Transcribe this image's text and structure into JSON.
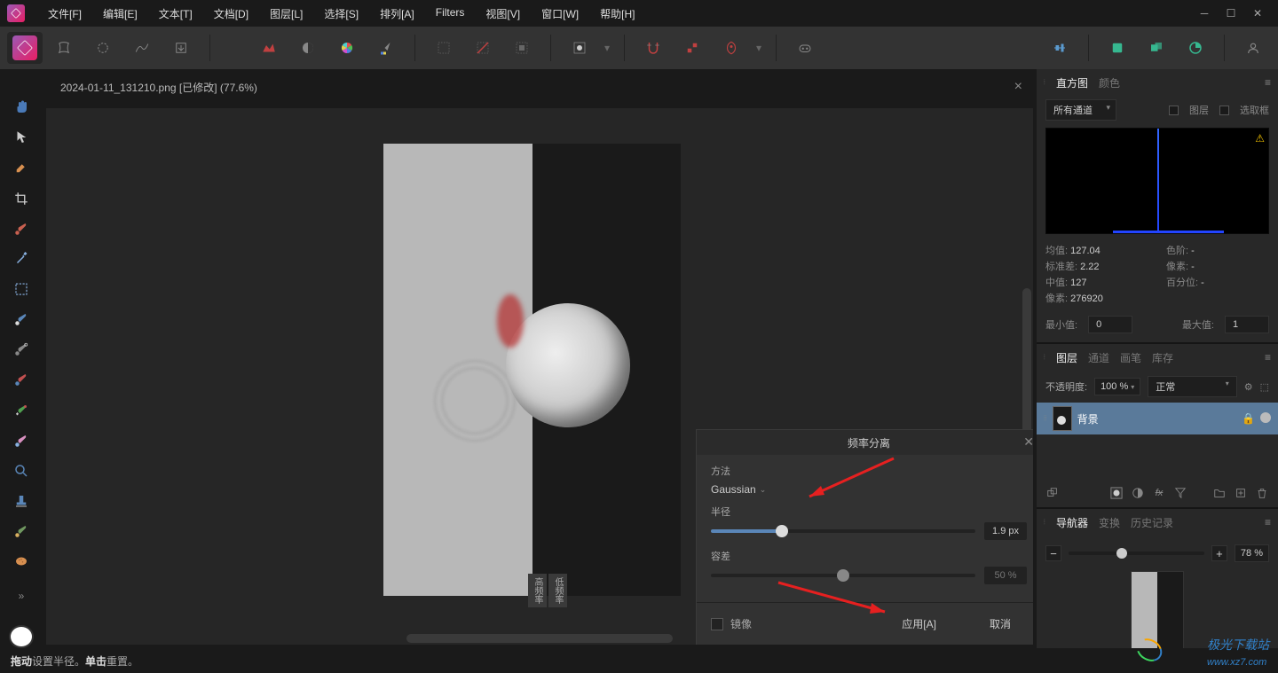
{
  "menu": {
    "file": "文件[F]",
    "edit": "编辑[E]",
    "text": "文本[T]",
    "document": "文档[D]",
    "layer": "图层[L]",
    "select": "选择[S]",
    "arrange": "排列[A]",
    "filters": "Filters",
    "view": "视图[V]",
    "window": "窗口[W]",
    "help": "帮助[H]"
  },
  "doc": {
    "tab_title": "2024-01-11_131210.png [已修改] (77.6%)",
    "split_high": "高频率",
    "split_low": "低频率"
  },
  "dialog": {
    "title": "频率分离",
    "method_label": "方法",
    "method_value": "Gaussian",
    "radius_label": "半径",
    "radius_value": "1.9 px",
    "tolerance_label": "容差",
    "tolerance_value": "50 %",
    "mirror": "镜像",
    "apply": "应用[A]",
    "cancel": "取消"
  },
  "histogram": {
    "tab1": "直方图",
    "tab2": "颜色",
    "channel": "所有通道",
    "opt_layer": "图层",
    "opt_selection": "选取框",
    "mean_lbl": "均值:",
    "mean_val": "127.04",
    "stddev_lbl": "标准差:",
    "stddev_val": "2.22",
    "median_lbl": "中值:",
    "median_val": "127",
    "pixels_lbl": "像素:",
    "pixels_val": "276920",
    "level_lbl": "色阶:",
    "level_val": "-",
    "px2_lbl": "像素:",
    "px2_val": "-",
    "pct_lbl": "百分位:",
    "pct_val": "-",
    "min_lbl": "最小值:",
    "min_val": "0",
    "max_lbl": "最大值:",
    "max_val": "1"
  },
  "layers": {
    "tab1": "图层",
    "tab2": "通道",
    "tab3": "画笔",
    "tab4": "库存",
    "opacity_lbl": "不透明度:",
    "opacity_val": "100 %",
    "blend": "正常",
    "layer_name": "背景"
  },
  "navigator": {
    "tab1": "导航器",
    "tab2": "变换",
    "tab3": "历史记录",
    "zoom": "78 %"
  },
  "status": {
    "drag_lbl": "拖动",
    "drag_txt": " 设置半径。",
    "click_lbl": "单击",
    "click_txt": " 重置。"
  },
  "watermark": {
    "text1": "极光下载站",
    "text2": "www.xz7.com"
  }
}
